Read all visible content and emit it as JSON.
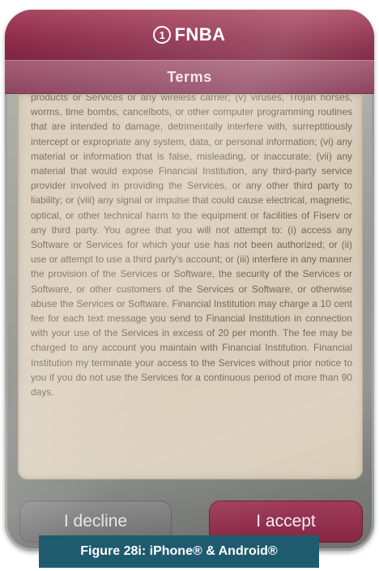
{
  "header": {
    "logo_mark": "1",
    "brand": "FNBA"
  },
  "subheader": {
    "title": "Terms"
  },
  "terms": {
    "text": "products or Services or any wireless carrier; (v) viruses, Trojan horses, worms, time bombs, cancelbots, or other computer programming routines that are intended to damage, detrimentally interfere with, surreptitiously intercept or expropriate any system, data, or personal information; (vi) any material or information that is false, misleading, or inaccurate; (vii) any material that would expose Financial Institution, any third-party service provider involved in providing the Services, or any other third party to liability; or (viii) any signal or impulse that could cause electrical, magnetic, optical, or other technical harm to the equipment or facilities of Fiserv or any third party. You agree that you will not attempt to: (i) access any Software or Services for which your use has not been authorized; or (ii) use or attempt to use a third party's account; or (iii) interfere in any manner the provision of the Services or Software, the security of the Services or Software, or other customers of the Services or Software, or otherwise abuse the Services or Software. Financial Institution may charge a 10 cent fee for each text message you send to Financial Institution in connection with your use of the Services in excess of 20 per month. The fee may be charged to any account you maintain with Financial Institution. Financial Institution my terminate your access to the Services without prior notice to you if you do not use the Services for a continuous period of more than 90 days."
  },
  "buttons": {
    "decline_label": "I decline",
    "accept_label": "I accept"
  },
  "caption": {
    "text": "Figure 28i: iPhone® & Android®"
  },
  "colors": {
    "brand_maroon": "#8e2b49",
    "terms_bg": "#d9ccb9",
    "decline_gray": "#6c6c6c",
    "caption_teal": "#1e5b6f"
  }
}
